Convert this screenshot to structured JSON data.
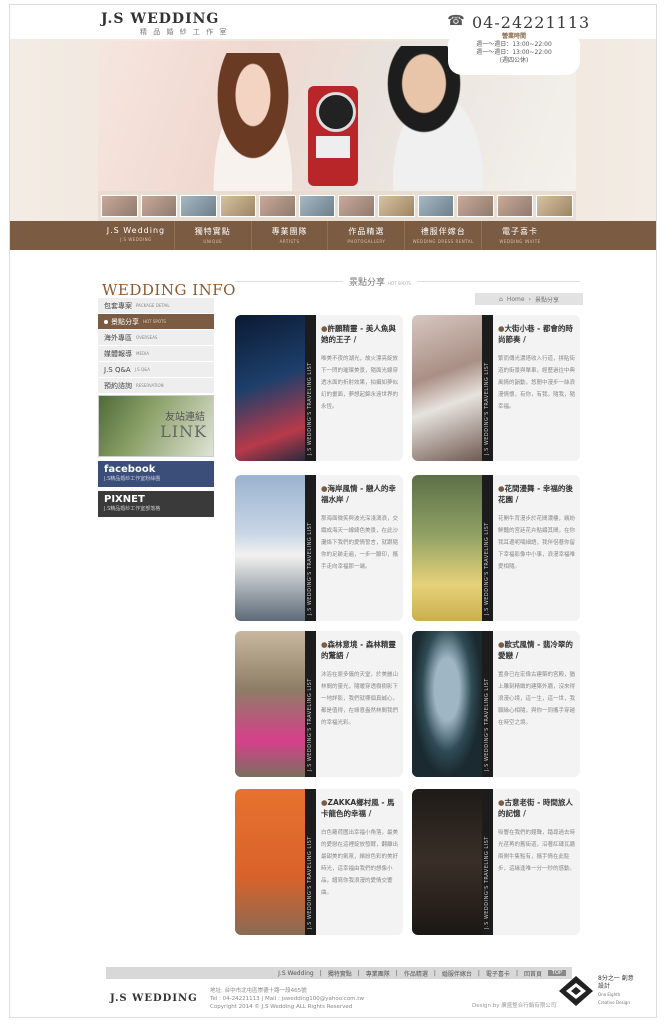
{
  "header": {
    "logo": "J.S WEDDING",
    "logo_sub": "精 品 婚 紗 工 作 室",
    "phone": "04-24221113",
    "hours_title": "營業時間",
    "hours": [
      "週一～週日：13:00~22:00",
      "週一～週日：13:00~22:00",
      "(週四公休)"
    ]
  },
  "nav": [
    {
      "label": "J.S Wedding",
      "sub": "J.S WEDDING"
    },
    {
      "label": "獨特實點",
      "sub": "UNIQUE"
    },
    {
      "label": "專業團隊",
      "sub": "ARTISTS"
    },
    {
      "label": "作品精選",
      "sub": "PHOTOGALLERY"
    },
    {
      "label": "禮服伴嫁台",
      "sub": "WEDDING DRESS RENTAL"
    },
    {
      "label": "電子喜卡",
      "sub": "WEDDING INVITE"
    }
  ],
  "sidebar": {
    "title": "WEDDING INFO",
    "items": [
      {
        "label": "包套專案",
        "sub": "PACKAGE DETAIL",
        "active": false
      },
      {
        "label": "景點分享",
        "sub": "HOT SPOTS",
        "active": true
      },
      {
        "label": "海外專區",
        "sub": "OVERSEAS",
        "active": false
      },
      {
        "label": "媒體報導",
        "sub": "MEDIA",
        "active": false
      },
      {
        "label": "J.S Q&A",
        "sub": "J.S Q&A",
        "active": false
      },
      {
        "label": "預約諮詢",
        "sub": "RESERVATION",
        "active": false
      }
    ],
    "friend_link_zh": "友站連結",
    "friend_link_en": "LINK",
    "facebook_label": "facebook",
    "facebook_sub": "J.S精品婚紗工作室粉絲團",
    "pixnet_label": "PIXNET",
    "pixnet_sub": "J.S精品婚紗工作室部落格"
  },
  "section": {
    "title": "景點分享",
    "title_sub": "HOT SPOTS",
    "breadcrumb_home": "Home",
    "breadcrumb_current": "景點分享"
  },
  "cards": [
    {
      "title": "許願精靈 - 美人魚與她的王子 /",
      "text": "唯美不夜的湖光，故火漂亮綻放下一閃的璀璨美景，隨面光線穿透水面的折射效果，拍攝如夢似幻的畫面，夢想起錦永遠世界的永恆。",
      "strip": "J.S WEDDING'S TRAVELING LIST"
    },
    {
      "title": "大街小巷 - 都會的時尚節奏 /",
      "text": "繁而傳光濃塔收入行道，拼貼街道的街景與單車，經歷過往中典風情的韻動，悠閒中漫步一絲浪漫情懷，有你，有我，隨我，隨幸福。",
      "strip": "J.S WEDDING'S TRAVELING LIST"
    },
    {
      "title": "海岸風情 - 戀人的幸福水岸 /",
      "text": "那海面微笑與波光深淺濤浪，交織成海天一線綺色美景，在此沙灘烙下我們的愛情誓言，就跟隨你的足跡走遍，一步一腳印，攜手走向幸福那一端。",
      "strip": "J.S WEDDING'S TRAVELING LIST"
    },
    {
      "title": "花間漫舞 - 幸福的後花園 /",
      "text": "花開牛背漫步於花間濃樓，繽紛鮮豔的宮廷花卉點綴其間，在你我耳邊呢喃細語，我伴侶著你留下幸福影像中小事，浪漫幸福唯愛相隨。",
      "strip": "J.S WEDDING'S TRAVELING LIST"
    },
    {
      "title": "森林意境 - 森林精靈的驚語 /",
      "text": "沐浴在原多儀的天堂，於美麗山林間的靈光，隨暖穿透樹樹影下一地詳影，我們就哪個真誠心，都是值得，在綠意盎然林間我們的幸福光彩。",
      "strip": "J.S WEDDING'S TRAVELING LIST"
    },
    {
      "title": "歐式風情 - 翡冷翠的愛戀 /",
      "text": "置身已在宏偉古建築的宮殿，猶上雕刻精緻的建築外牆，沒來得浪漫心境，這一生，這一世，我願緣心相隨，與你一同攜手穿越在時空之境。",
      "strip": "J.S WEDDING'S TRAVELING LIST"
    },
    {
      "title": "ZAKKA鄉村風 - 馬卡龍色的幸福 /",
      "text": "白色蘿荷圍出幸福小角落，最美的愛戀在這裡綻放發酵，翻離出最甜美的氣氛，繽紛色彩的美好時光，這幸福由我們的想像小品，譜寫你我浪漫的愛情交響曲。",
      "strip": "J.S WEDDING'S TRAVELING LIST"
    },
    {
      "title": "古意老街 - 時間旅人的記憶 /",
      "text": "吸響在我們的鐘聲，踏尋過去時光荏苒的舊街道，沿著紅磚瓦牆兩側牛隻點有，攜手情在此駐步，這緣逢唯一分一秒的感動。",
      "strip": "J.S WEDDING'S TRAVELING LIST"
    }
  ],
  "footer": {
    "links": [
      "J.S Wedding",
      "獨特實點",
      "專業團隊",
      "作品精選",
      "婚服伴嫁台",
      "電子喜卡",
      "回首頁"
    ],
    "top": "TOP",
    "logo": "J.S WEDDING",
    "address": "地址: 台中市北屯區崇德十路一段465號",
    "contact": "Tel : 04-24221113  |  Mail : jswedding100@yahoo.com.tw",
    "copyright": "Copyright 2014 © J.S Wedding ALL Rights Reserved",
    "design": "Design by 廣盛整合行銷有限公司",
    "design_logo_text": "8分之一 創意設計",
    "design_logo_en": "One Eighth Creative Design"
  },
  "colors": {
    "accent": "#7b5c43",
    "title": "#8b5a34"
  }
}
